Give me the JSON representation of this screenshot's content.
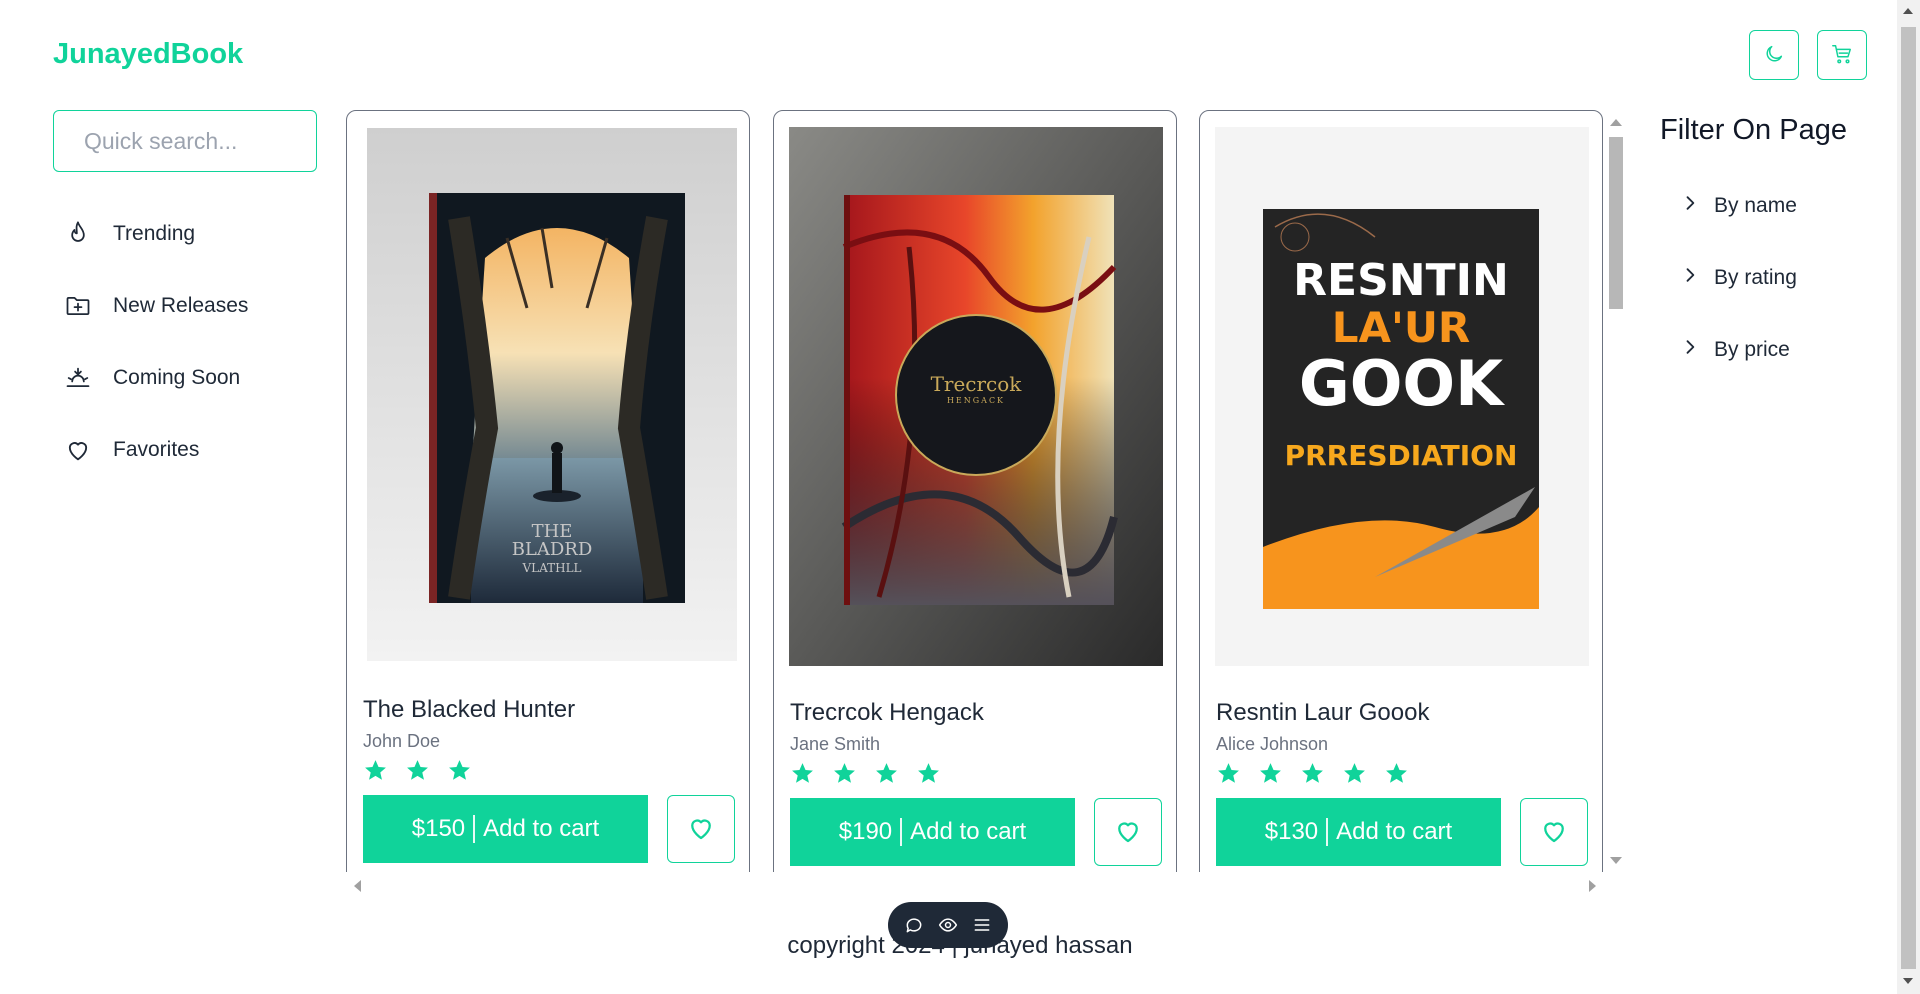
{
  "brand": "JunayedBook",
  "header": {
    "theme_icon": "moon-icon",
    "cart_icon": "cart-icon"
  },
  "search": {
    "placeholder": "Quick search...",
    "value": ""
  },
  "sidebar": {
    "items": [
      {
        "label": "Trending",
        "icon": "flame-icon"
      },
      {
        "label": "New Releases",
        "icon": "folder-plus-icon"
      },
      {
        "label": "Coming Soon",
        "icon": "sunrise-icon"
      },
      {
        "label": "Favorites",
        "icon": "heart-icon"
      }
    ]
  },
  "books": [
    {
      "title": "The Blacked Hunter",
      "author": "John Doe",
      "rating": 3,
      "price": "$150",
      "cta": "Add to cart",
      "cover_text": [
        "THE",
        "BLADRD",
        "VLATHLL"
      ],
      "cover_colors": [
        "#e8a85a",
        "#1e2a3a"
      ]
    },
    {
      "title": "Trecrcok Hengack",
      "author": "Jane Smith",
      "rating": 4,
      "price": "$190",
      "cta": "Add to cart",
      "cover_text": [
        "Trecrcok",
        "HENGACK"
      ],
      "cover_colors": [
        "#c8242a",
        "#f3a22c"
      ]
    },
    {
      "title": "Resntin Laur Goook",
      "author": "Alice Johnson",
      "rating": 5,
      "price": "$130",
      "cta": "Add to cart",
      "cover_text": [
        "RESNTIN",
        "LA'UR",
        "GOOK",
        "PRRESDIATION"
      ],
      "cover_colors": [
        "#2a2a2a",
        "#f7941d"
      ]
    }
  ],
  "filter": {
    "title": "Filter On Page",
    "items": [
      "By name",
      "By rating",
      "By price"
    ]
  },
  "footer": {
    "copyright": "copyright 2024 | junayed hassan"
  },
  "colors": {
    "accent": "#10d39a",
    "star": "#10d39a",
    "text": "#1f2937",
    "muted": "#6b7280"
  }
}
